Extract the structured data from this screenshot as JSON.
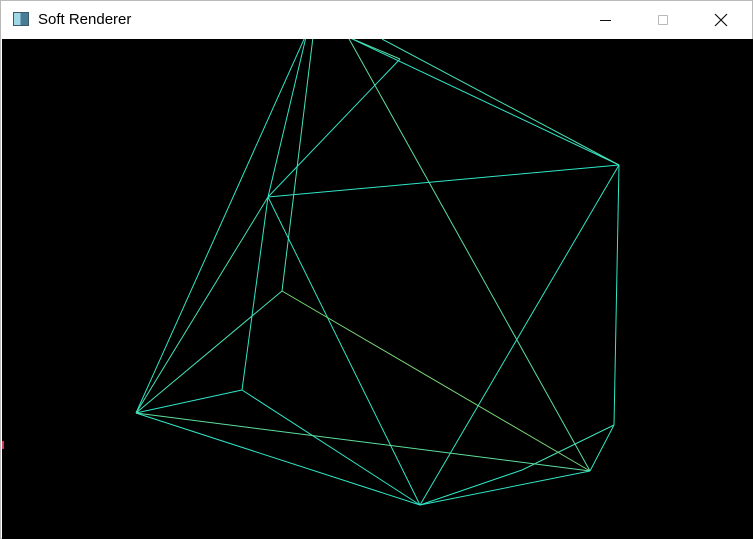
{
  "window": {
    "title": "Soft Renderer",
    "icon": "app-window-icon",
    "controls": {
      "minimize": "minimize-icon",
      "maximize": "maximize-icon",
      "close": "close-icon"
    }
  },
  "viewport": {
    "background": "#000000",
    "line_colors": [
      "#30e6c6",
      "#46e2b8",
      "#5ddf9e",
      "#7bd978"
    ],
    "edge_marker_color": "#d83a52"
  }
}
